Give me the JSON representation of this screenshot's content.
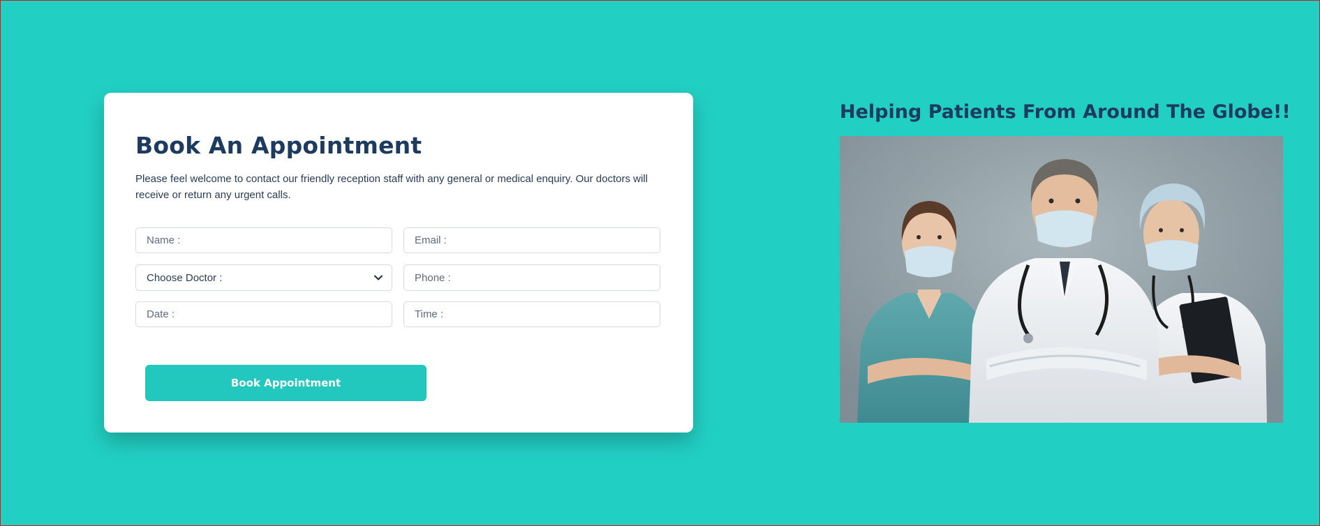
{
  "colors": {
    "page_background": "#22cfc3",
    "card_background": "#ffffff",
    "heading": "#1d3a5f",
    "button": "#22c7bd",
    "button_text": "#ffffff",
    "page_border": "#d11b1b"
  },
  "appointment": {
    "title": "Book An Appointment",
    "description": "Please feel welcome to contact our friendly reception staff with any general or medical enquiry. Our doctors will receive or return any urgent calls.",
    "fields": {
      "name_placeholder": "Name :",
      "email_placeholder": "Email :",
      "doctor_selected": "Choose Doctor :",
      "phone_placeholder": "Phone :",
      "date_placeholder": "Date :",
      "time_placeholder": "Time :"
    },
    "submit_label": "Book Appointment"
  },
  "showcase": {
    "heading": "Helping Patients From Around The Globe!!",
    "image_subject": "doctors-and-nurses-photo"
  },
  "icons": {
    "select_arrow": "chevron-down-icon"
  }
}
